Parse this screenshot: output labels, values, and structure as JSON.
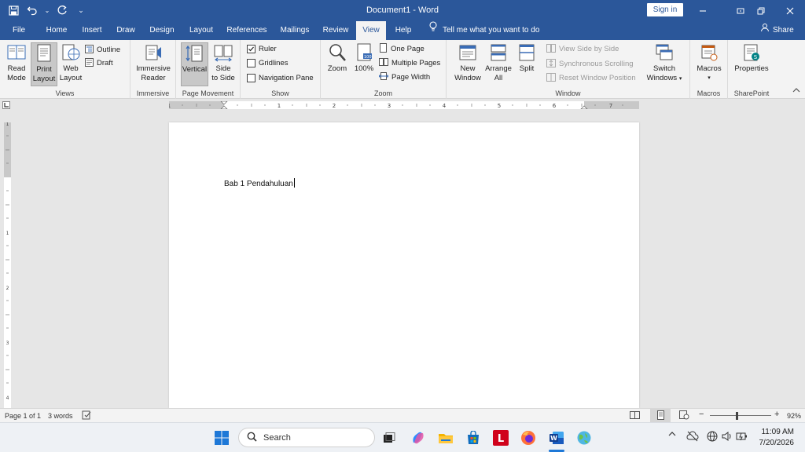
{
  "window": {
    "title": "Document1  -  Word",
    "sign_in": "Sign in"
  },
  "tabs": [
    "File",
    "Home",
    "Insert",
    "Draw",
    "Design",
    "Layout",
    "References",
    "Mailings",
    "Review",
    "View",
    "Help"
  ],
  "active_tab": "View",
  "tell_me": "Tell me what you want to do",
  "share": "Share",
  "ribbon": {
    "views": {
      "label": "Views",
      "read_mode": [
        "Read",
        "Mode"
      ],
      "print_layout": [
        "Print",
        "Layout"
      ],
      "web_layout": [
        "Web",
        "Layout"
      ],
      "outline": "Outline",
      "draft": "Draft"
    },
    "immersive": {
      "label": "Immersive",
      "immersive_reader": [
        "Immersive",
        "Reader"
      ]
    },
    "page_movement": {
      "label": "Page Movement",
      "vertical": "Vertical",
      "side_to_side": [
        "Side",
        "to Side"
      ]
    },
    "show": {
      "label": "Show",
      "ruler": "Ruler",
      "gridlines": "Gridlines",
      "navigation_pane": "Navigation Pane",
      "ruler_checked": true
    },
    "zoom": {
      "label": "Zoom",
      "zoom": "Zoom",
      "hundred": "100%",
      "one_page": "One Page",
      "multiple_pages": "Multiple Pages",
      "page_width": "Page Width"
    },
    "window": {
      "label": "Window",
      "new_window": [
        "New",
        "Window"
      ],
      "arrange_all": [
        "Arrange",
        "All"
      ],
      "split": "Split",
      "view_side_by_side": "View Side by Side",
      "synchronous_scrolling": "Synchronous Scrolling",
      "reset_window_position": "Reset Window Position",
      "switch_windows": [
        "Switch",
        "Windows"
      ]
    },
    "macros": {
      "label": "Macros",
      "macros": "Macros"
    },
    "sharepoint": {
      "label": "SharePoint",
      "properties": "Properties"
    }
  },
  "ruler_numbers": [
    "1",
    "1",
    "2",
    "3",
    "4",
    "5",
    "6",
    "7"
  ],
  "vruler_numbers": [
    "1",
    "1",
    "2",
    "3",
    "4"
  ],
  "document": {
    "text": "Bab 1 Pendahuluan"
  },
  "status": {
    "page": "Page 1 of 1",
    "words": "3 words",
    "zoom": "92%",
    "zoom_minus": "−",
    "zoom_plus": "+"
  },
  "taskbar": {
    "search": "Search",
    "time": "11:09 AM",
    "date": "7/20/2026"
  },
  "colors": {
    "word_blue": "#2b579a",
    "ribbon_bg": "#f3f3f3"
  }
}
